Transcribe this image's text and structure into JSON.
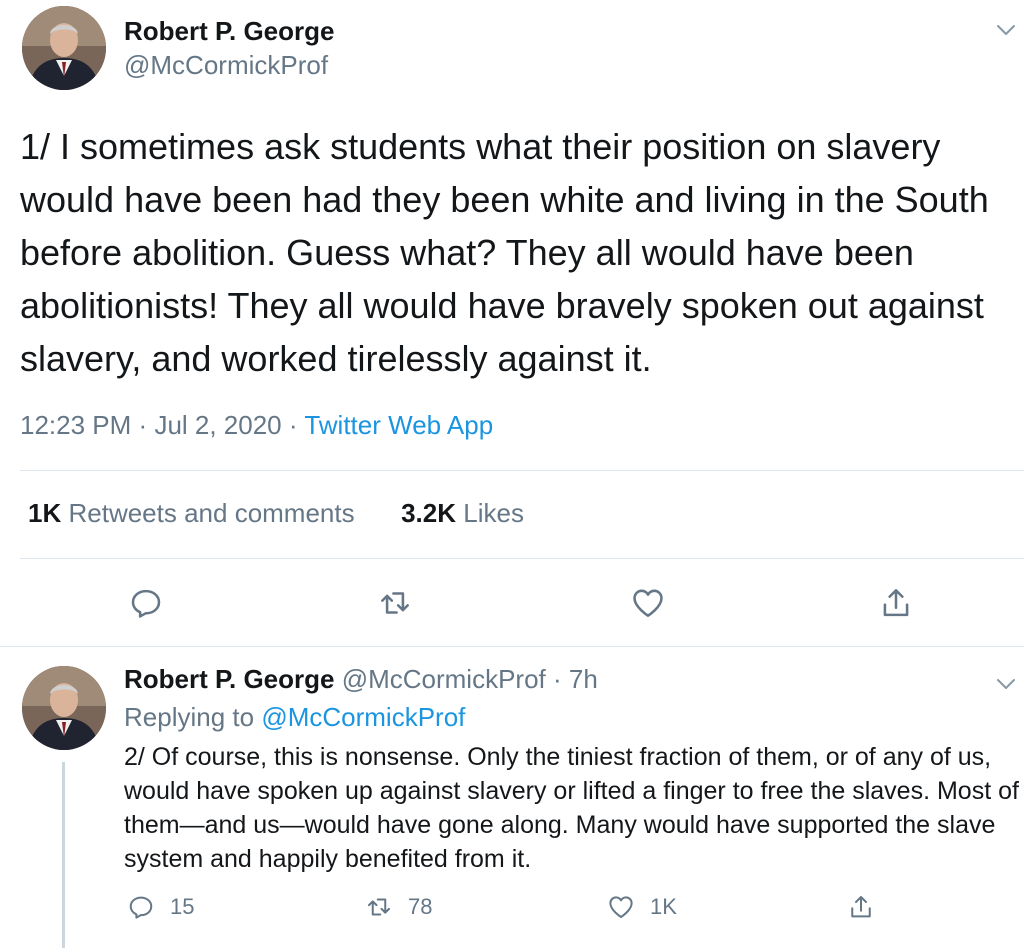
{
  "tweet": {
    "author_name": "Robert P. George",
    "author_handle": "@McCormickProf",
    "text": "1/ I sometimes ask students what their position on slavery would have been had they been white and living in the South before abolition. Guess what? They all would have been abolitionists! They all would have bravely spoken out against slavery, and worked tirelessly against it.",
    "time": "12:23 PM",
    "date": "Jul 2, 2020",
    "separator": "·",
    "source": "Twitter Web App",
    "retweets_count": "1K",
    "retweets_label": "Retweets and comments",
    "likes_count": "3.2K",
    "likes_label": "Likes"
  },
  "reply": {
    "author_name": "Robert P. George",
    "author_handle": "@McCormickProf",
    "separator": "·",
    "age": "7h",
    "replying_label": "Replying to",
    "replying_to": "@McCormickProf",
    "text": "2/ Of course, this is nonsense. Only the tiniest fraction of them, or of any of us, would have spoken up against slavery or lifted a finger to free the slaves. Most of them—and us—would have gone along. Many would have supported the slave system and happily benefited from it.",
    "replies_count": "15",
    "retweets_count": "78",
    "likes_count": "1K"
  },
  "icons": {
    "reply": "reply-icon",
    "retweet": "retweet-icon",
    "like": "heart-icon",
    "share": "share-icon",
    "menu": "chevron-down-icon"
  },
  "colors": {
    "text": "#14171a",
    "secondary": "#657786",
    "link": "#1b95e0",
    "divider": "#e1e8ed"
  }
}
